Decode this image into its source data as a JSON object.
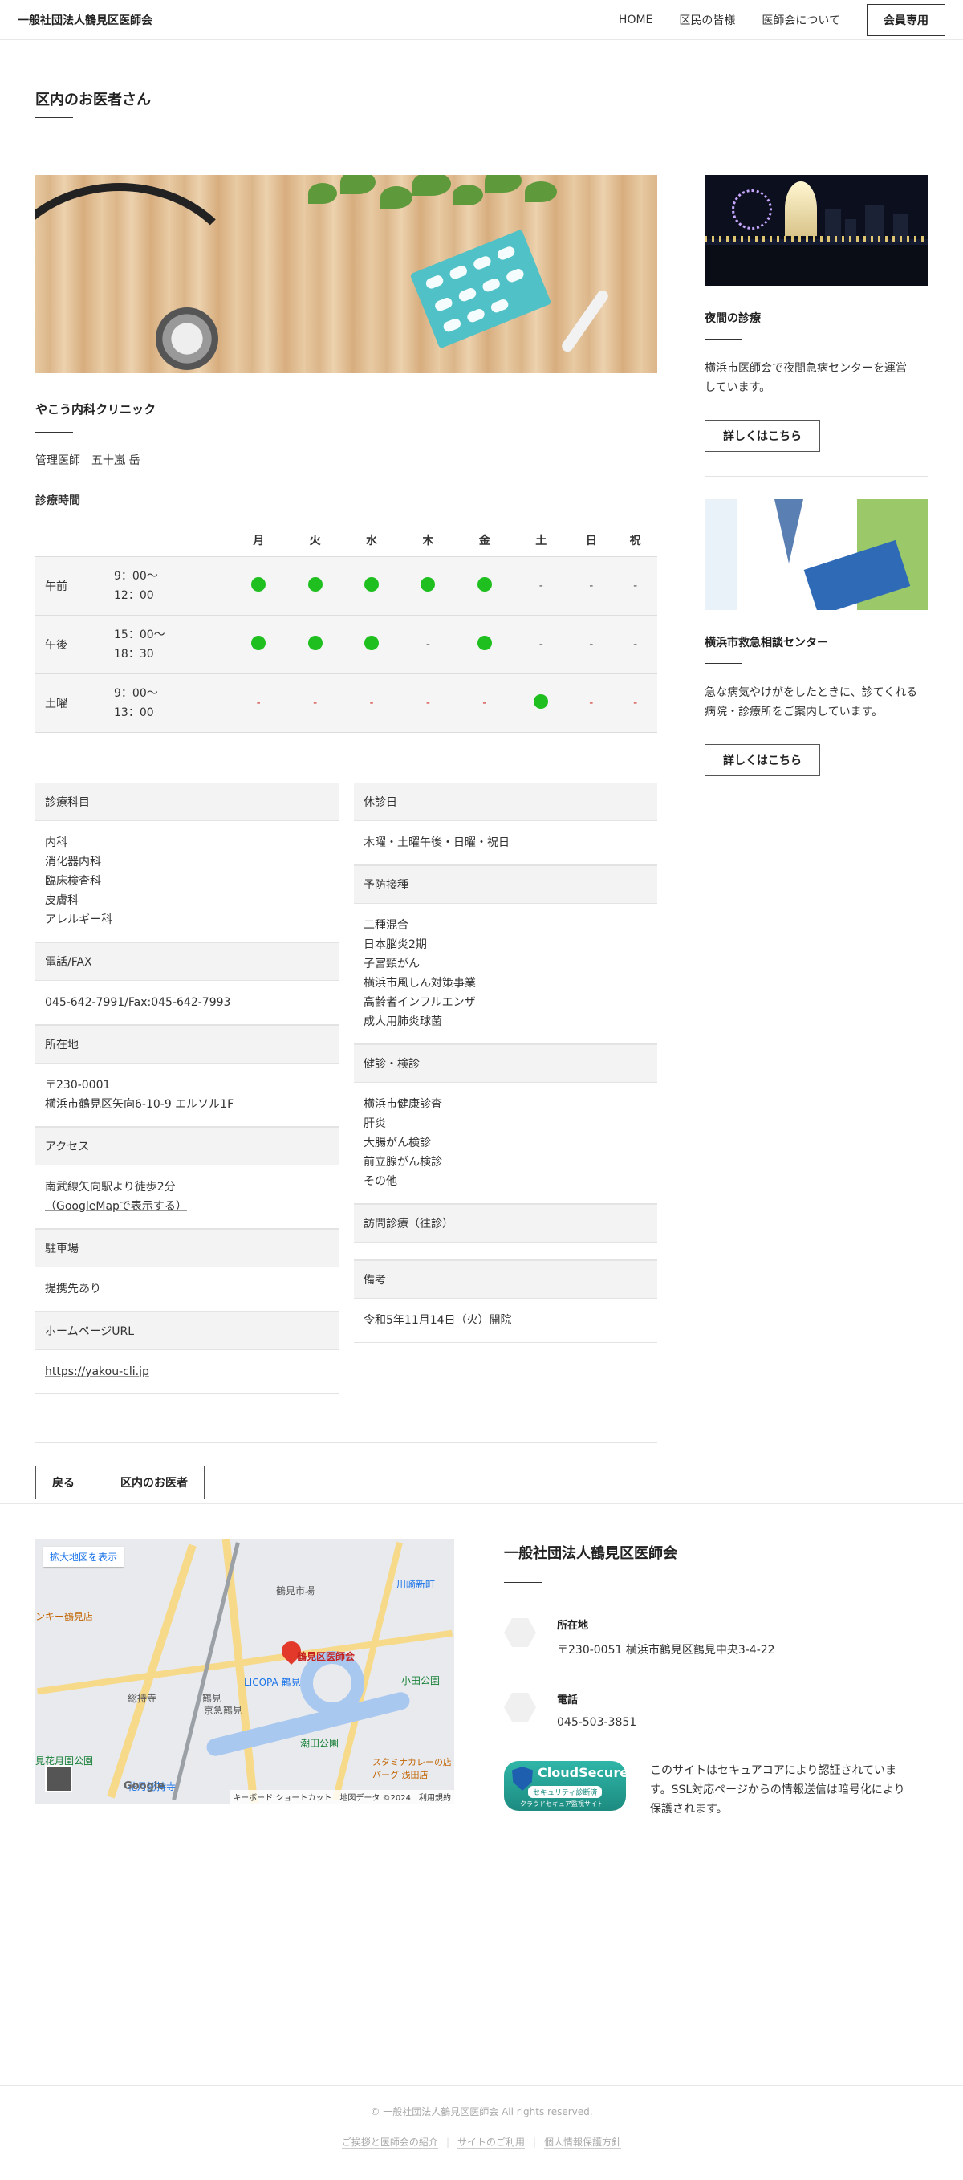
{
  "header": {
    "logo": "一般社団法人鶴見区医師会",
    "nav": [
      "HOME",
      "区民の皆様",
      "医師会について"
    ],
    "member_button": "会員専用"
  },
  "page_title": "区内のお医者さん",
  "clinic": {
    "name": "やこう内科クリニック",
    "manager_label": "管理医師",
    "manager_name": "五十嵐 岳",
    "hours_label": "診療時間"
  },
  "hours_table": {
    "days": [
      "月",
      "火",
      "水",
      "木",
      "金",
      "土",
      "日",
      "祝"
    ],
    "rows": [
      {
        "slot": "午前",
        "time1": "9：00〜",
        "time2": "12：00",
        "cells": [
          "open",
          "open",
          "open",
          "open",
          "open",
          "-",
          "-",
          "-"
        ]
      },
      {
        "slot": "午後",
        "time1": "15：00〜",
        "time2": "18：30",
        "cells": [
          "open",
          "open",
          "open",
          "-",
          "open",
          "-",
          "-",
          "-"
        ]
      },
      {
        "slot": "土曜",
        "time1": "9：00〜",
        "time2": "13：00",
        "cells": [
          "-r",
          "-r",
          "-r",
          "-r",
          "-r",
          "open",
          "-r",
          "-r"
        ]
      }
    ]
  },
  "details": {
    "dept_head": "診療科目",
    "depts": [
      "内科",
      "消化器内科",
      "臨床検査科",
      "皮膚科",
      "アレルギー科"
    ],
    "tel_head": "電話/FAX",
    "tel": "045-642-7991/Fax:045-642-7993",
    "addr_head": "所在地",
    "addr1": "〒230-0001",
    "addr2": "横浜市鶴見区矢向6-10-9 エルソル1F",
    "access_head": "アクセス",
    "access1": "南武線矢向駅より徒歩2分",
    "access2": "（GoogleMapで表示する）",
    "parking_head": "駐車場",
    "parking": "提携先あり",
    "url_head": "ホームページURL",
    "url": "https://yakou-cli.jp",
    "closed_head": "休診日",
    "closed": "木曜・土曜午後・日曜・祝日",
    "vacc_head": "予防接種",
    "vaccs": [
      "二種混合",
      "日本脳炎2期",
      "子宮頸がん",
      "横浜市風しん対策事業",
      "高齢者インフルエンザ",
      "成人用肺炎球菌"
    ],
    "check_head": "健診・検診",
    "checks": [
      "横浜市健康診査",
      "肝炎",
      "大腸がん検診",
      "前立腺がん検診",
      "その他"
    ],
    "visit_head": "訪問診療（往診）",
    "note_head": "備考",
    "note": "令和5年11月14日（火）開院"
  },
  "buttons": {
    "back": "戻る",
    "list": "区内のお医者"
  },
  "sidebar": [
    {
      "title": "夜間の診療",
      "text1": "横浜市医師会で夜間急病センターを運営",
      "text2": "しています。",
      "button": "詳しくはこちら"
    },
    {
      "title": "横浜市救急相談センター",
      "text1": "急な病気やけがをしたときに、診てくれる",
      "text2": "病院・診療所をご案内しています。",
      "button": "詳しくはこちら"
    }
  ],
  "map": {
    "enlarge": "拡大地図を表示",
    "marker": "鶴見区医師会",
    "labels": [
      "鶴見市場",
      "川崎新町",
      "LICOPA 鶴見",
      "京急鶴見",
      "鶴見",
      "総持寺",
      "潮田公園",
      "花月総持寺",
      "見花月園公園",
      "小田公園",
      "スタミナカレーの店 バーグ 浅田店",
      "ンキー鶴見店"
    ],
    "attribution": "キーボード ショートカット　地図データ ©2024　利用規約",
    "google": "Google"
  },
  "footer": {
    "org": "一般社団法人鶴見区医師会",
    "addr_label": "所在地",
    "addr": "〒230-0051 横浜市鶴見区鶴見中央3-4-22",
    "tel_label": "電話",
    "tel": "045-503-3851",
    "badge_main": "CloudSecure",
    "badge_sub": "セキュリティ診断済",
    "badge_foot": "クラウドセキュア監視サイト",
    "secure_text": "このサイトはセキュアコアにより認証されています。SSL対応ページからの情報送信は暗号化により保護されます。",
    "copyright": "© 一般社団法人鶴見区医師会 All rights reserved.",
    "links": [
      "ご挨拶と医師会の紹介",
      "サイトのご利用",
      "個人情報保護方針"
    ]
  },
  "colors": {
    "open_dot": "#1fbf1f",
    "closed_dash_red": "#d0312d",
    "head_bg": "#f3f3f3"
  }
}
